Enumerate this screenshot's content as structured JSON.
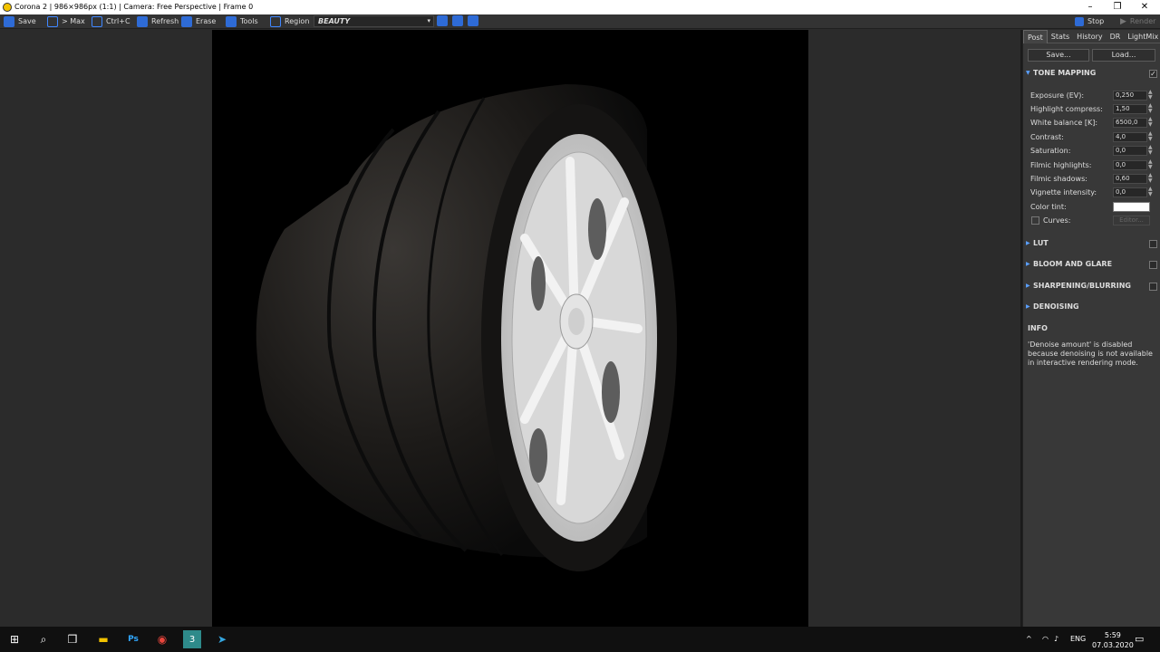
{
  "window": {
    "title": "Corona 2 | 986×986px (1:1) | Camera: Free Perspective | Frame 0",
    "controls": [
      "–",
      "❐",
      "✕"
    ]
  },
  "toolbar": {
    "save": "Save",
    "max": "> Max",
    "ctrlc": "Ctrl+C",
    "refresh": "Refresh",
    "erase": "Erase",
    "tools": "Tools",
    "region": "Region",
    "pass": "BEAUTY",
    "stop": "Stop",
    "render": "Render"
  },
  "panel": {
    "tabs": [
      "Post",
      "Stats",
      "History",
      "DR",
      "LightMix"
    ],
    "save_btn": "Save...",
    "load_btn": "Load...",
    "tone_mapping": {
      "title": "TONE MAPPING",
      "enabled": "✓",
      "rows": [
        {
          "label": "Exposure (EV):",
          "value": "0,250"
        },
        {
          "label": "Highlight compress:",
          "value": "1,50"
        },
        {
          "label": "White balance [K]:",
          "value": "6500,0"
        },
        {
          "label": "Contrast:",
          "value": "4,0"
        },
        {
          "label": "Saturation:",
          "value": "0,0"
        },
        {
          "label": "Filmic highlights:",
          "value": "0,0"
        },
        {
          "label": "Filmic shadows:",
          "value": "0,60"
        },
        {
          "label": "Vignette intensity:",
          "value": "0,0"
        }
      ],
      "color_tint_label": "Color tint:",
      "color_tint": "#ffffff",
      "curves_label": "Curves:",
      "editor_btn": "Editor..."
    },
    "sections": [
      "LUT",
      "BLOOM AND GLARE",
      "SHARPENING/BLURRING",
      "DENOISING"
    ],
    "info_title": "INFO",
    "info_text": "'Denoise amount' is disabled because denoising is not available in interactive rendering mode."
  },
  "taskbar": {
    "lang": "ENG",
    "time": "5:59",
    "date": "07.03.2020"
  },
  "colors": {
    "accent": "#2e6bd6",
    "panel_bg": "#383838",
    "viewport_bg": "#000000"
  }
}
